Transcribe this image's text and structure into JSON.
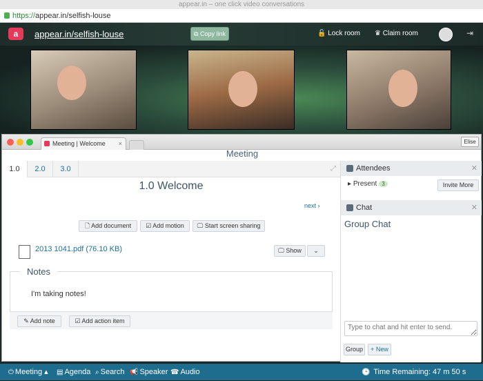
{
  "chrome": {
    "window_title": "appear.in – one click video conversations",
    "url_https": "https://",
    "url_rest": "appear.in/selfish-louse"
  },
  "appear": {
    "logo": "a",
    "room_url": "appear.in/selfish-louse",
    "copy_link": "Copy link",
    "lock_room": "Lock room",
    "claim_room": "Claim room"
  },
  "window": {
    "tab_title": "Meeting | Welcome",
    "profile": "Elise"
  },
  "meeting": {
    "heading": "Meeting",
    "tabs": [
      "1.0",
      "2.0",
      "3.0"
    ],
    "item_title": "1.0 Welcome",
    "next": "next ›",
    "add_document": "Add document",
    "add_motion": "Add motion",
    "screen_share": "Start screen sharing",
    "document": "2013 1041.pdf (76.10 KB)",
    "show": "Show",
    "notes_title": "Notes",
    "notes_text": "I'm taking notes!",
    "add_note": "Add note",
    "add_action": "Add action item"
  },
  "attendees": {
    "title": "Attendees",
    "present": "Present",
    "present_count": "3",
    "invite": "Invite More"
  },
  "chat": {
    "title": "Chat",
    "group_title": "Group Chat",
    "placeholder": "Type to chat and hit enter to send.",
    "tab_group": "Group",
    "tab_new": "New"
  },
  "bottom": {
    "meeting": "Meeting",
    "agenda": "Agenda",
    "search": "Search",
    "speaker": "Speaker",
    "audio": "Audio",
    "time_remaining": "Time Remaining: 47 m 50 s"
  }
}
